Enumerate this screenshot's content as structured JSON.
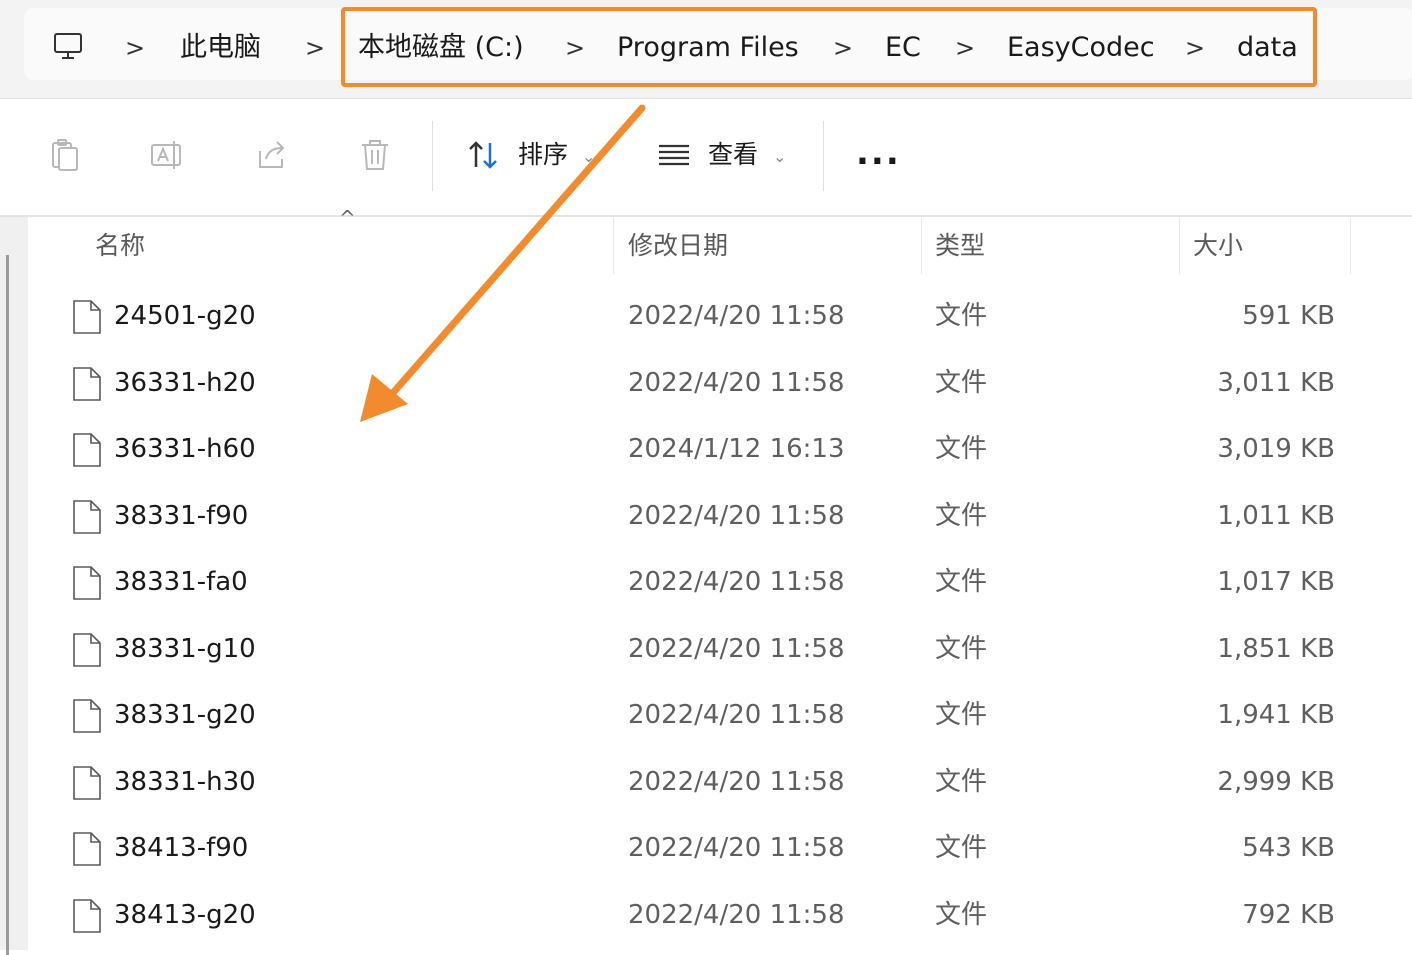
{
  "breadcrumb": {
    "items": [
      "此电脑",
      "本地磁盘 (C:)",
      "Program Files",
      "EC",
      "EasyCodec",
      "data"
    ],
    "separator": ">"
  },
  "toolbar": {
    "sort_label": "排序",
    "view_label": "查看",
    "more_label": "..."
  },
  "columns": {
    "name": "名称",
    "modified": "修改日期",
    "type": "类型",
    "size": "大小"
  },
  "files": [
    {
      "name": "24501-g20",
      "modified": "2022/4/20 11:58",
      "type": "文件",
      "size": "591 KB"
    },
    {
      "name": "36331-h20",
      "modified": "2022/4/20 11:58",
      "type": "文件",
      "size": "3,011 KB"
    },
    {
      "name": "36331-h60",
      "modified": "2024/1/12 16:13",
      "type": "文件",
      "size": "3,019 KB"
    },
    {
      "name": "38331-f90",
      "modified": "2022/4/20 11:58",
      "type": "文件",
      "size": "1,011 KB"
    },
    {
      "name": "38331-fa0",
      "modified": "2022/4/20 11:58",
      "type": "文件",
      "size": "1,017 KB"
    },
    {
      "name": "38331-g10",
      "modified": "2022/4/20 11:58",
      "type": "文件",
      "size": "1,851 KB"
    },
    {
      "name": "38331-g20",
      "modified": "2022/4/20 11:58",
      "type": "文件",
      "size": "1,941 KB"
    },
    {
      "name": "38331-h30",
      "modified": "2022/4/20 11:58",
      "type": "文件",
      "size": "2,999 KB"
    },
    {
      "name": "38413-f90",
      "modified": "2022/4/20 11:58",
      "type": "文件",
      "size": "543 KB"
    },
    {
      "name": "38413-g20",
      "modified": "2022/4/20 11:58",
      "type": "文件",
      "size": "792 KB"
    }
  ],
  "colors": {
    "annotation_orange": "#f28a2e",
    "secondary_text": "#5f5f5f"
  }
}
